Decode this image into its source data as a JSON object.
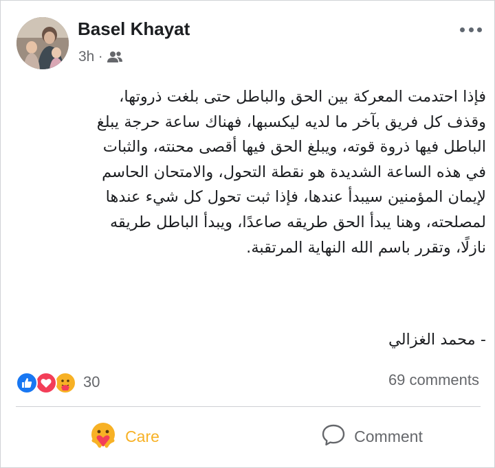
{
  "post": {
    "author": "Basel Khayat",
    "time": "3h",
    "separator": "·",
    "audience_icon": "friends-icon",
    "more_icon": "more-horizontal-icon",
    "body_lines": [
      "فإذا احتدمت المعركة بين الحق والباطل حتى بلغت ذروتها،",
      "وقذف كل فريق بآخر ما لديه ليكسبها، فهناك ساعة حرجة يبلغ",
      "الباطل فيها ذروة قوته، ويبلغ الحق فيها أقصى محنته، والثبات",
      "في هذه الساعة الشديدة هو نقطة التحول، والامتحان الحاسم",
      "لإيمان المؤمنين سيبدأ عندها، فإذا ثبت تحول كل شيء عندها",
      "لمصلحته، وهنا يبدأ الحق طريقه صاعدًا، ويبدأ الباطل طريقه",
      "نازلًا، وتقرر باسم الله النهاية المرتقبة."
    ],
    "signature": "- محمد الغزالي"
  },
  "stats": {
    "reactions": [
      "like",
      "love",
      "care"
    ],
    "reaction_count": "30",
    "comments": "69 comments"
  },
  "actions": {
    "care_label": "Care",
    "comment_label": "Comment"
  },
  "colors": {
    "like": "#1877f2",
    "love": "#f33e58",
    "care": "#f7b125",
    "muted_text": "#65676b"
  }
}
